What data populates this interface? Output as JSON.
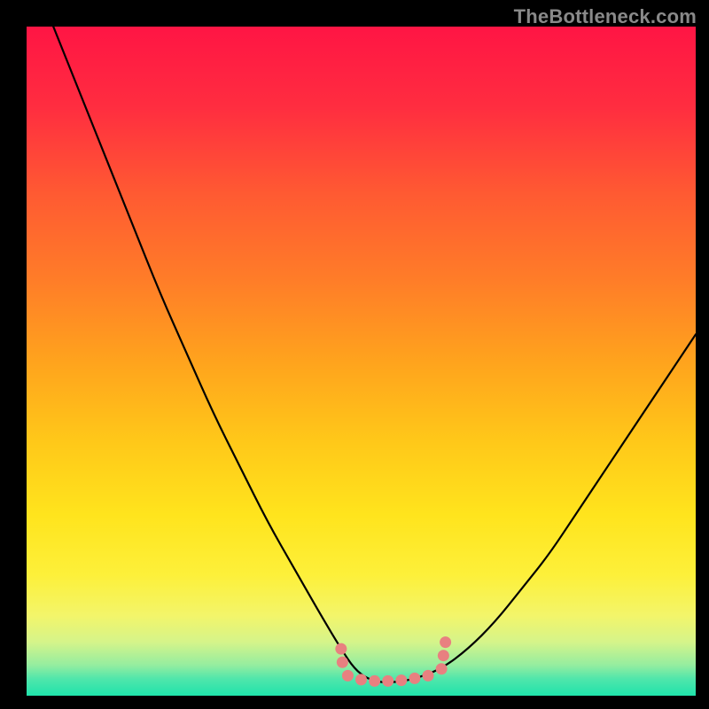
{
  "watermark": "TheBottleneck.com",
  "gradient": {
    "stops": [
      {
        "offset": 0.0,
        "color": "#ff1544"
      },
      {
        "offset": 0.12,
        "color": "#ff2d40"
      },
      {
        "offset": 0.25,
        "color": "#ff5a32"
      },
      {
        "offset": 0.38,
        "color": "#ff7d28"
      },
      {
        "offset": 0.5,
        "color": "#ffa31d"
      },
      {
        "offset": 0.62,
        "color": "#ffc819"
      },
      {
        "offset": 0.73,
        "color": "#ffe41d"
      },
      {
        "offset": 0.82,
        "color": "#fdf03a"
      },
      {
        "offset": 0.88,
        "color": "#f3f56a"
      },
      {
        "offset": 0.92,
        "color": "#d5f48a"
      },
      {
        "offset": 0.955,
        "color": "#93eda0"
      },
      {
        "offset": 0.975,
        "color": "#4fe6ab"
      },
      {
        "offset": 1.0,
        "color": "#1fe3ab"
      }
    ]
  },
  "chart_data": {
    "type": "line",
    "title": "",
    "xlabel": "",
    "ylabel": "",
    "xlim": [
      0,
      100
    ],
    "ylim": [
      0,
      100
    ],
    "series": [
      {
        "name": "bottleneck-curve",
        "x": [
          4,
          8,
          12,
          16,
          20,
          24,
          28,
          32,
          36,
          40,
          44,
          47,
          49,
          51,
          53,
          55,
          58,
          62,
          66,
          70,
          74,
          78,
          82,
          86,
          90,
          94,
          98,
          100
        ],
        "y": [
          100,
          90,
          80,
          70,
          60,
          51,
          42,
          34,
          26,
          19,
          12,
          7,
          4,
          2.5,
          2,
          2,
          2.5,
          4,
          7,
          11,
          16,
          21,
          27,
          33,
          39,
          45,
          51,
          54
        ]
      }
    ],
    "markers": [
      {
        "x": 47.0,
        "y": 7.0
      },
      {
        "x": 47.2,
        "y": 5.0
      },
      {
        "x": 48.0,
        "y": 3.0
      },
      {
        "x": 50.0,
        "y": 2.4
      },
      {
        "x": 52.0,
        "y": 2.2
      },
      {
        "x": 54.0,
        "y": 2.2
      },
      {
        "x": 56.0,
        "y": 2.3
      },
      {
        "x": 58.0,
        "y": 2.6
      },
      {
        "x": 60.0,
        "y": 3.0
      },
      {
        "x": 62.0,
        "y": 4.0
      },
      {
        "x": 62.3,
        "y": 6.0
      },
      {
        "x": 62.6,
        "y": 8.0
      }
    ]
  }
}
